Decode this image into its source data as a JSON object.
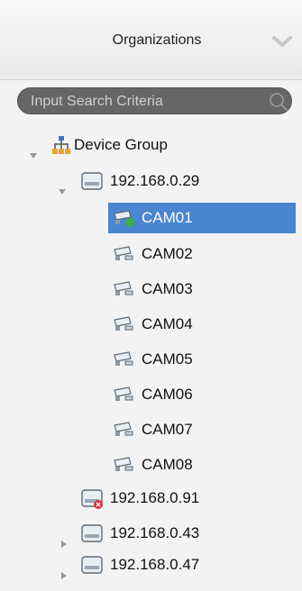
{
  "panel": {
    "title": "Organizations",
    "collapse_icon": "chevron-down-icon"
  },
  "search": {
    "placeholder": "Input Search Criteria",
    "value": "",
    "icon": "search-icon"
  },
  "tree": {
    "root": {
      "label": "Device Group",
      "expanded": true,
      "icon": "organization-icon"
    },
    "devices": [
      {
        "label": "192.168.0.29",
        "expanded": true,
        "status": "online",
        "cameras": [
          {
            "label": "CAM01",
            "selected": true,
            "status": "online"
          },
          {
            "label": "CAM02",
            "selected": false
          },
          {
            "label": "CAM03",
            "selected": false
          },
          {
            "label": "CAM04",
            "selected": false
          },
          {
            "label": "CAM05",
            "selected": false
          },
          {
            "label": "CAM06",
            "selected": false
          },
          {
            "label": "CAM07",
            "selected": false
          },
          {
            "label": "CAM08",
            "selected": false
          }
        ]
      },
      {
        "label": "192.168.0.91",
        "expanded": false,
        "status": "offline",
        "has_children": false
      },
      {
        "label": "192.168.0.43",
        "expanded": false,
        "status": "online",
        "has_children": true
      },
      {
        "label": "192.168.0.47",
        "expanded": false,
        "status": "online",
        "has_children": true
      }
    ]
  },
  "colors": {
    "selection": "#4a86cf",
    "search_bg": "#666666",
    "offline_badge": "#d9343a",
    "online_badge": "#3cb043"
  }
}
